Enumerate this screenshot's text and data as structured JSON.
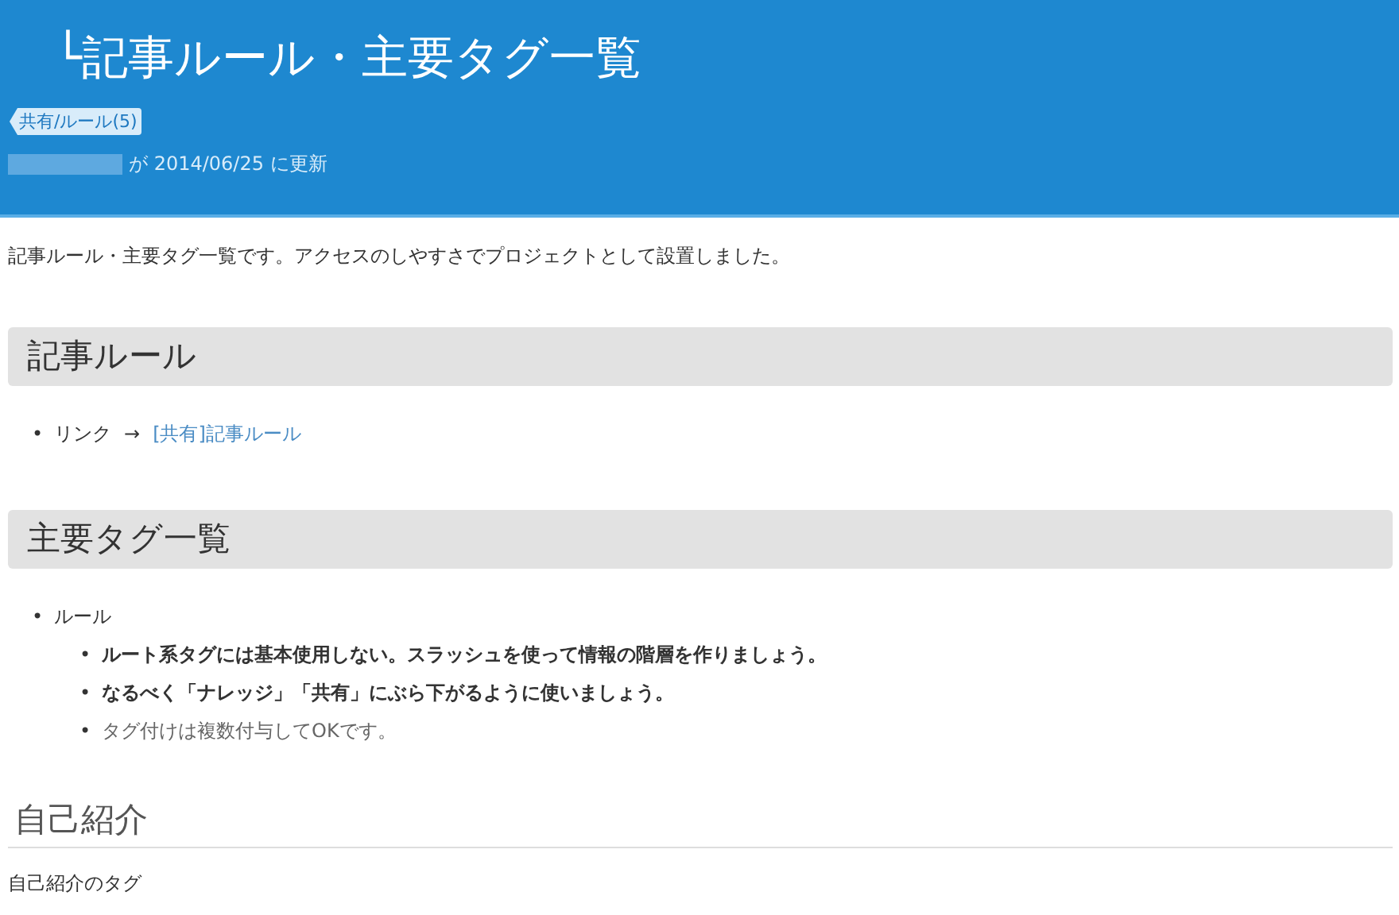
{
  "header": {
    "title": "└記事ルール・主要タグ一覧",
    "tag": "共有/ルール(5)",
    "updated": {
      "author_redacted": true,
      "text": "が 2014/06/25 に更新"
    }
  },
  "intro": "記事ルール・主要タグ一覧です。アクセスのしやすさでプロジェクトとして設置しました。",
  "sections": [
    {
      "kind": "band",
      "heading": "記事ルール",
      "items": [
        {
          "bullet": "•",
          "text": "リンク",
          "arrow": "→",
          "link": "[共有]記事ルール"
        }
      ]
    },
    {
      "kind": "band",
      "heading": "主要タグ一覧",
      "items": [
        {
          "bullet": "•",
          "text": "ルール",
          "children": [
            {
              "bullet": "•",
              "text": "ルート系タグには基本使用しない。スラッシュを使って情報の階層を作りましょう。",
              "bold": true
            },
            {
              "bullet": "•",
              "text": "なるべく「ナレッジ」「共有」にぶら下がるように使いましょう。",
              "bold": true
            },
            {
              "bullet": "•",
              "text": "タグ付けは複数付与してOKです。",
              "bold": false
            }
          ]
        }
      ]
    },
    {
      "kind": "underline",
      "heading": "自己紹介",
      "paragraph": "自己紹介のタグ"
    }
  ]
}
